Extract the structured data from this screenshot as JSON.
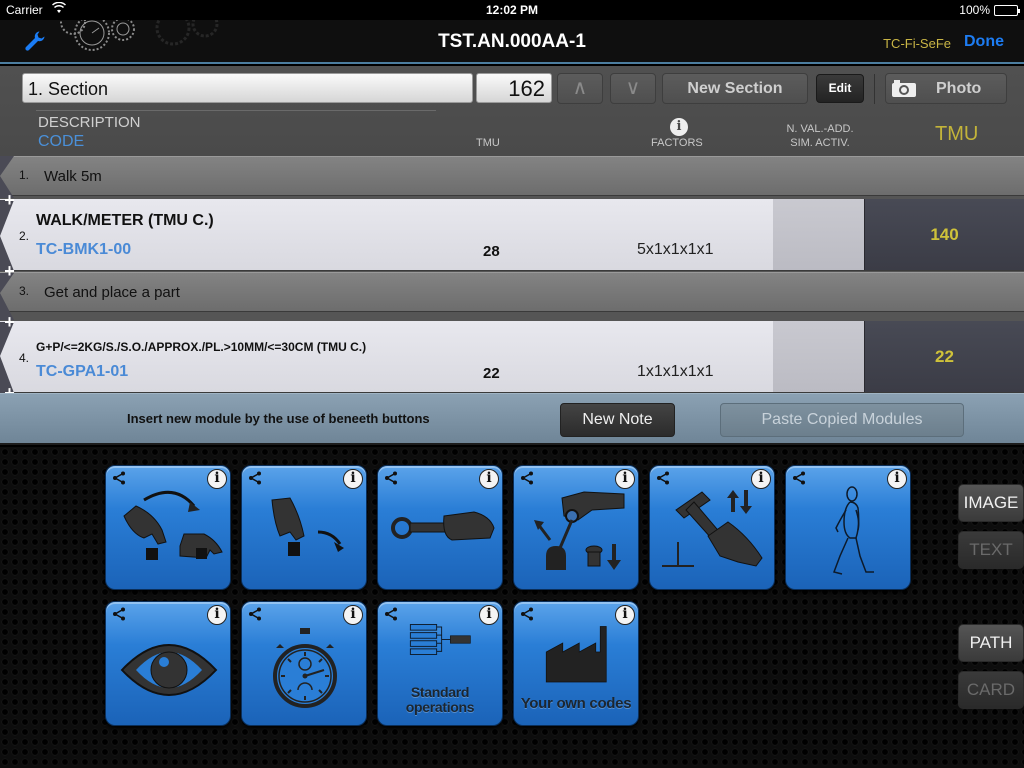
{
  "status_bar": {
    "carrier": "Carrier",
    "time": "12:02 PM",
    "battery": "100%"
  },
  "nav_bar": {
    "title": "TST.AN.000AA-1",
    "user_code": "TC-Fi-SeFe",
    "done_label": "Done",
    "left_icon": "wrench-icon"
  },
  "toolbar": {
    "section_value": "1. Section",
    "section_tmu": "162",
    "up_label": "∧",
    "down_label": "∨",
    "new_section_label": "New Section",
    "edit_label": "Edit",
    "photo_label": "Photo"
  },
  "columns": {
    "description": "DESCRIPTION",
    "code": "CODE",
    "tmu": "TMU",
    "info": "i",
    "factors": "FACTORS",
    "nva_line1": "N. VAL.-ADD.",
    "nva_line2": "SIM. ACTIV.",
    "tmu_total": "TMU"
  },
  "rows": [
    {
      "type": "note",
      "number": "1.",
      "text": "Walk 5m"
    },
    {
      "type": "module",
      "number": "2.",
      "description": "WALK/METER (TMU C.)",
      "code": "TC-BMK1-00",
      "tmu": "28",
      "factors": "5x1x1x1x1",
      "total": "140"
    },
    {
      "type": "note",
      "number": "3.",
      "text": "Get and place a part"
    },
    {
      "type": "module",
      "number": "4.",
      "description": "G+P/<=2KG/S./S.O./APPROX./PL.>10MM/<=30CM (TMU C.)",
      "code": "TC-GPA1-01",
      "tmu": "22",
      "factors": "1x1x1x1x1",
      "total": "22"
    }
  ],
  "insert_bar": {
    "hint": "Insert new module by the use of beneeth buttons",
    "new_note_label": "New Note",
    "paste_label": "Paste Copied Modules"
  },
  "palette": {
    "tiles": [
      {
        "name": "get-and-place",
        "icon": "hand-move-object-icon",
        "caption": ""
      },
      {
        "name": "place",
        "icon": "hand-release-icon",
        "caption": ""
      },
      {
        "name": "tool-use",
        "icon": "wrench-hand-icon",
        "caption": ""
      },
      {
        "name": "operate-controls",
        "icon": "lever-button-icon",
        "caption": ""
      },
      {
        "name": "hammer",
        "icon": "hammer-hand-icon",
        "caption": ""
      },
      {
        "name": "walk",
        "icon": "walking-person-icon",
        "caption": ""
      },
      {
        "name": "visual-check",
        "icon": "eye-icon",
        "caption": ""
      },
      {
        "name": "process-time",
        "icon": "stopwatch-icon",
        "caption": ""
      },
      {
        "name": "standard-operations",
        "icon": "hierarchy-icon",
        "caption": "Standard operations"
      },
      {
        "name": "own-codes",
        "icon": "factory-icon",
        "caption": "Your own codes"
      }
    ],
    "side_buttons": {
      "image": "IMAGE",
      "text": "TEXT",
      "path": "PATH",
      "card": "CARD"
    }
  }
}
